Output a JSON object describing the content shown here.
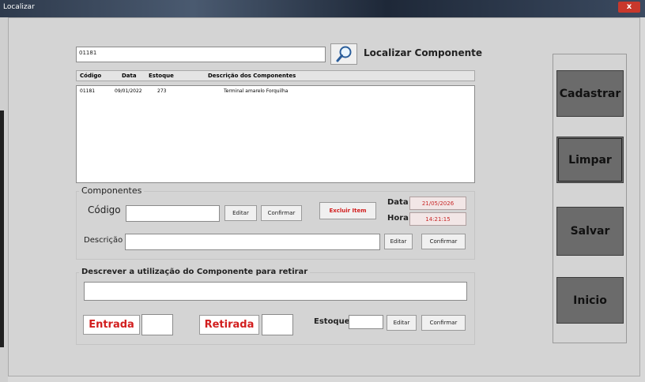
{
  "window": {
    "title": "Localizar",
    "close_glyph": "x"
  },
  "search": {
    "value": "01181",
    "button_label": "Localizar Componente",
    "icon": "magnifier-icon"
  },
  "list": {
    "columns": [
      "Código",
      "Data",
      "Estoque",
      "Descrição dos Componentes"
    ],
    "rows": [
      {
        "codigo": "01181",
        "data": "09/01/2022",
        "estoque": "273",
        "descricao": "Terminal amarelo Forquilha"
      }
    ]
  },
  "componentes": {
    "title": "Componentes",
    "codigo_label": "Código",
    "codigo_value": "",
    "editar_label": "Editar",
    "confirmar_label": "Confirmar",
    "excluir_label": "Excluir Item",
    "data_label": "Data",
    "data_value": "21/05/2026",
    "hora_label": "Hora",
    "hora_value": "14:21:15",
    "descricao_label": "Descrição",
    "descricao_value": "",
    "editar2_label": "Editar",
    "confirmar2_label": "Confirmar"
  },
  "utilizacao": {
    "title": "Descrever a utilização do Componente  para retirar",
    "text_value": "",
    "entrada_label": "Entrada",
    "entrada_value": "",
    "retirada_label": "Retirada",
    "retirada_value": "",
    "estoque_label": "Estoque",
    "estoque_value": "",
    "editar_label": "Editar",
    "confirmar_label": "Confirmar"
  },
  "actions": {
    "cadastrar": "Cadastrar",
    "limpar": "Limpar",
    "salvar": "Salvar",
    "inicio": "Inicio"
  },
  "colors": {
    "accent_red": "#d21e1e",
    "action_gray": "#6b6b6b"
  }
}
